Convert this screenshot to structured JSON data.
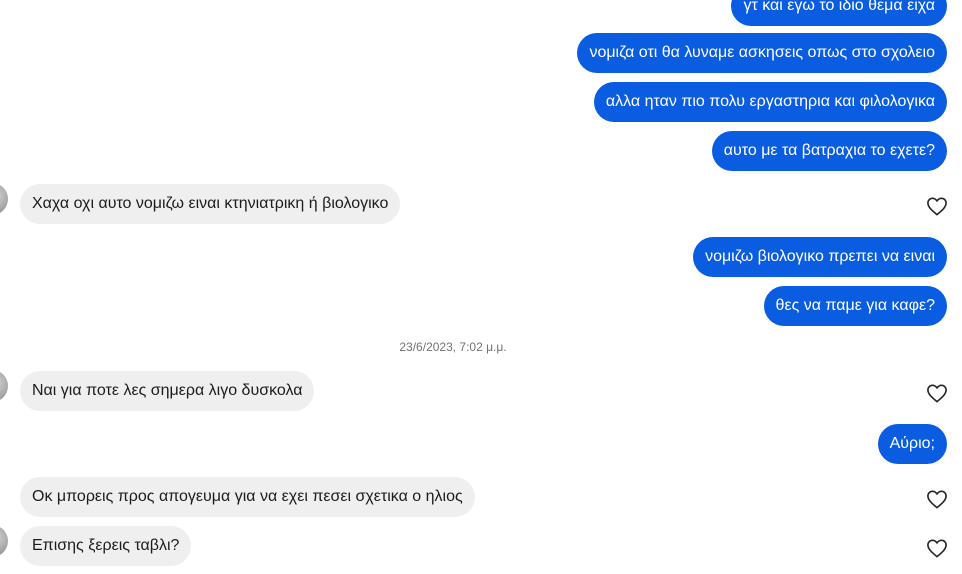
{
  "conversation": {
    "date_separator": "23/6/2023, 7:02 μ.μ.",
    "messages": [
      {
        "direction": "out",
        "text": "γτ και εγω το ιδιο θεμα ειχα"
      },
      {
        "direction": "out",
        "text": "νομιζα οτι θα λυναμε ασκησεις οπως στο σχολειο"
      },
      {
        "direction": "out",
        "text": "αλλα ηταν πιο πολυ εργαστηρια και φιλολογικα"
      },
      {
        "direction": "out",
        "text": "αυτο με τα βατραχια το εχετε?"
      },
      {
        "direction": "in",
        "text": "Χαχα οχι αυτο νομιζω ειναι κτηνιατρικη ή βιολογικο"
      },
      {
        "direction": "out",
        "text": "νομιζω βιολογικο πρεπει να ειναι"
      },
      {
        "direction": "out",
        "text": "θες να παμε για καφε?"
      },
      {
        "direction": "in",
        "text": "Ναι για ποτε λες σημερα λιγο δυσκολα"
      },
      {
        "direction": "out",
        "text": "Αύριο;"
      },
      {
        "direction": "in",
        "text": "Οκ μπορεις προς απογευμα για να εχει πεσει σχετικα ο ηλιος"
      },
      {
        "direction": "in",
        "text": "Επισης ξερεις ταβλι?"
      }
    ]
  },
  "icons": {
    "like": "heart-outline-icon",
    "avatar": "contact-avatar"
  },
  "colors": {
    "outgoing_bubble": "#0a5ce0",
    "incoming_bubble": "#efefef",
    "heart": "#262626"
  }
}
